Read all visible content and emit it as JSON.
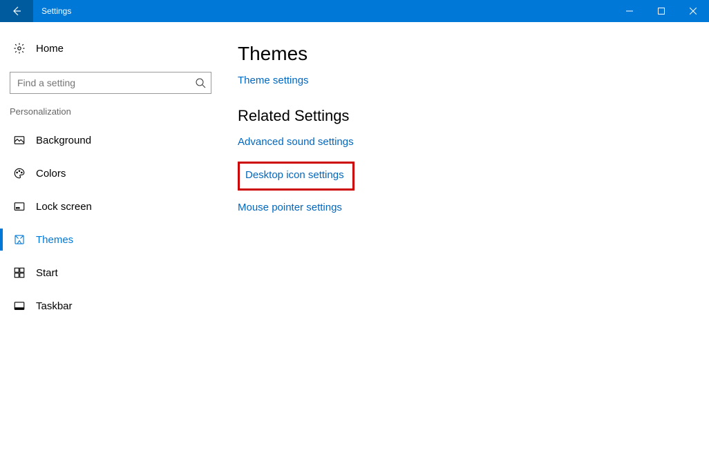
{
  "window": {
    "title": "Settings"
  },
  "sidebar": {
    "home": "Home",
    "search_placeholder": "Find a setting",
    "section": "Personalization",
    "items": [
      {
        "label": "Background"
      },
      {
        "label": "Colors"
      },
      {
        "label": "Lock screen"
      },
      {
        "label": "Themes"
      },
      {
        "label": "Start"
      },
      {
        "label": "Taskbar"
      }
    ]
  },
  "main": {
    "heading": "Themes",
    "theme_settings_link": "Theme settings",
    "related_heading": "Related Settings",
    "links": {
      "advanced_sound": "Advanced sound settings",
      "desktop_icon": "Desktop icon settings",
      "mouse_pointer": "Mouse pointer settings"
    }
  }
}
